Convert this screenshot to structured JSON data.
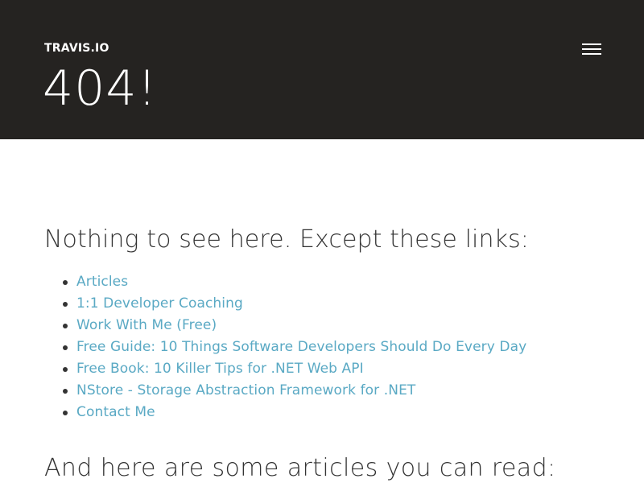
{
  "header": {
    "brand": "TRAVIS.IO",
    "title": "404!",
    "menu_icon": "hamburger-menu-icon"
  },
  "main": {
    "links_heading": "Nothing to see here. Except these links:",
    "links": [
      {
        "label": "Articles"
      },
      {
        "label": "1:1 Developer Coaching"
      },
      {
        "label": "Work With Me (Free)"
      },
      {
        "label": "Free Guide: 10 Things Software Developers Should Do Every Day"
      },
      {
        "label": "Free Book: 10 Killer Tips for .NET Web API"
      },
      {
        "label": "NStore - Storage Abstraction Framework for .NET"
      },
      {
        "label": "Contact Me"
      }
    ],
    "articles_heading": "And here are some articles you can read:"
  },
  "colors": {
    "header_background": "#252321",
    "link": "#5aa9c4",
    "text": "#333333"
  }
}
